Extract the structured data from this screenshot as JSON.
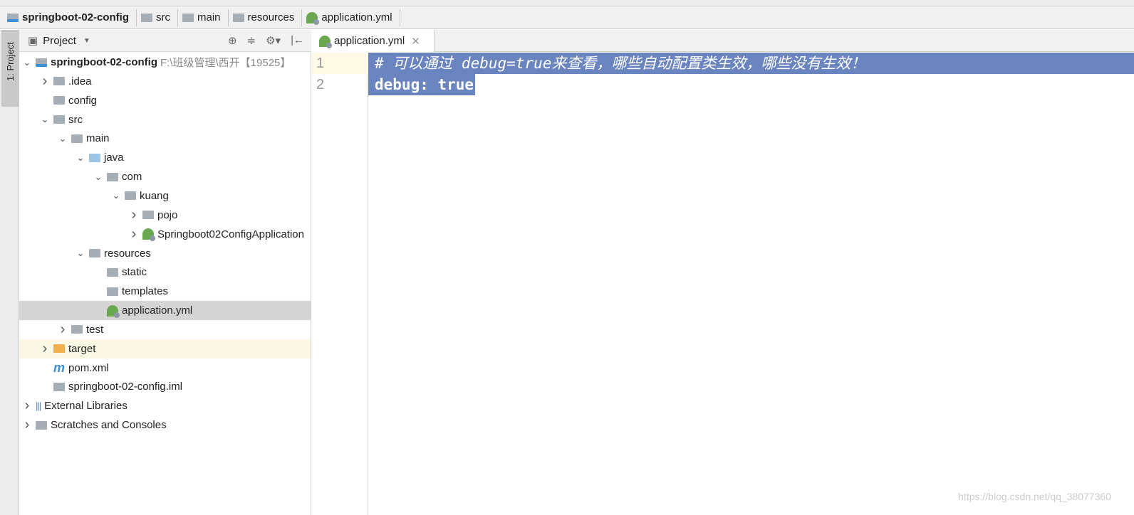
{
  "breadcrumbs": [
    {
      "label": "springboot-02-config",
      "icon": "module-folder-icon"
    },
    {
      "label": "src",
      "icon": "folder-icon"
    },
    {
      "label": "main",
      "icon": "folder-icon"
    },
    {
      "label": "resources",
      "icon": "resources-folder-icon"
    },
    {
      "label": "application.yml",
      "icon": "spring-yml-icon"
    }
  ],
  "side_tab": "1: Project",
  "project_panel": {
    "title": "Project"
  },
  "tree": [
    {
      "label": "springboot-02-config",
      "hint": "F:\\班级管理\\西开【19525】",
      "bold": true,
      "level": 0,
      "arrow": "expanded",
      "icon": "module"
    },
    {
      "label": ".idea",
      "level": 1,
      "arrow": "collapsed",
      "icon": "folder"
    },
    {
      "label": "config",
      "level": 1,
      "arrow": "",
      "icon": "folder"
    },
    {
      "label": "src",
      "level": 1,
      "arrow": "expanded",
      "icon": "folder"
    },
    {
      "label": "main",
      "level": 2,
      "arrow": "expanded",
      "icon": "folder"
    },
    {
      "label": "java",
      "level": 3,
      "arrow": "expanded",
      "icon": "source"
    },
    {
      "label": "com",
      "level": 4,
      "arrow": "expanded",
      "icon": "package"
    },
    {
      "label": "kuang",
      "level": 5,
      "arrow": "expanded",
      "icon": "package"
    },
    {
      "label": "pojo",
      "level": 6,
      "arrow": "collapsed",
      "icon": "package"
    },
    {
      "label": "Springboot02ConfigApplication",
      "level": 6,
      "arrow": "collapsed",
      "icon": "class"
    },
    {
      "label": "resources",
      "level": 3,
      "arrow": "expanded",
      "icon": "resources"
    },
    {
      "label": "static",
      "level": 4,
      "arrow": "",
      "icon": "folder"
    },
    {
      "label": "templates",
      "level": 4,
      "arrow": "",
      "icon": "folder"
    },
    {
      "label": "application.yml",
      "level": 4,
      "arrow": "",
      "icon": "yml",
      "selected": true
    },
    {
      "label": "test",
      "level": 2,
      "arrow": "collapsed",
      "icon": "folder"
    },
    {
      "label": "target",
      "level": 1,
      "arrow": "collapsed",
      "icon": "excluded",
      "excluded": true
    },
    {
      "label": "pom.xml",
      "level": 1,
      "arrow": "",
      "icon": "maven"
    },
    {
      "label": "springboot-02-config.iml",
      "level": 1,
      "arrow": "",
      "icon": "iml"
    },
    {
      "label": "External Libraries",
      "level": 0,
      "arrow": "collapsed",
      "icon": "libraries"
    },
    {
      "label": "Scratches and Consoles",
      "level": 0,
      "arrow": "collapsed",
      "icon": "scratches"
    }
  ],
  "editor": {
    "tab": "application.yml",
    "lines": [
      {
        "num": "1",
        "text": "# 可以通过 debug=true来查看，哪些自动配置类生效，哪些没有生效！"
      },
      {
        "num": "2",
        "text": "debug: true"
      }
    ],
    "selection_color": "#6a84bf"
  },
  "watermark": "https://blog.csdn.net/qq_38077360"
}
